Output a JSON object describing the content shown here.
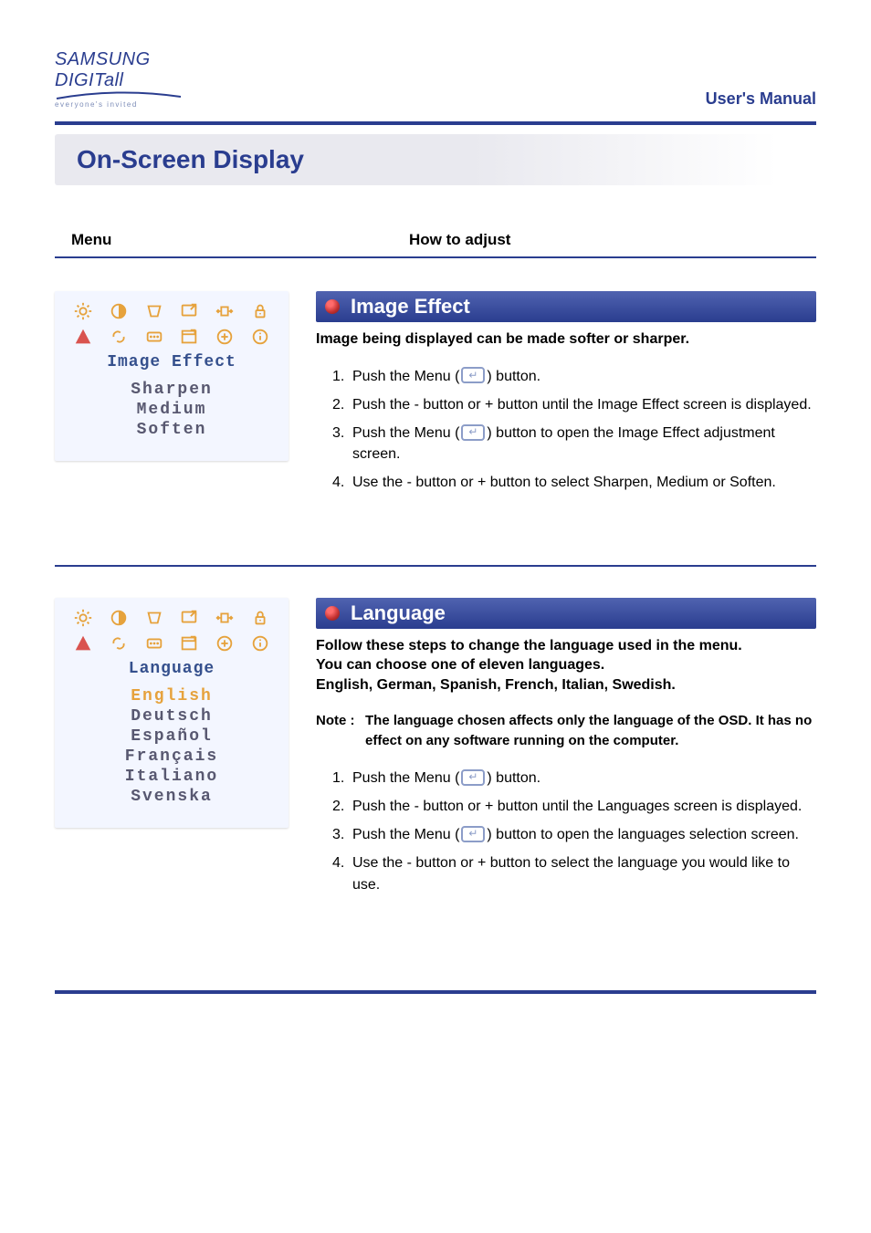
{
  "header": {
    "brand": "SAMSUNG DIGITall",
    "tagline": "everyone's invited",
    "manual": "User's Manual"
  },
  "page_title": "On-Screen Display",
  "column_headers": {
    "menu": "Menu",
    "howto": "How to adjust"
  },
  "sections": [
    {
      "osd": {
        "title": "Image Effect",
        "options": [
          "Sharpen",
          "Medium",
          "Soften"
        ],
        "selected_index": -1
      },
      "heading": "Image Effect",
      "intro": "Image being displayed can be made softer or sharper.",
      "steps": [
        {
          "pre": "Push the Menu (",
          "mid_icon": true,
          "post": ") button."
        },
        {
          "text": "Push the - button or + button until the Image Effect screen is displayed."
        },
        {
          "pre": "Push the Menu (",
          "mid_icon": true,
          "post": ") button to open the Image Effect adjustment screen."
        },
        {
          "text": "Use the - button or + button to select Sharpen, Medium or Soften."
        }
      ]
    },
    {
      "osd": {
        "title": "Language",
        "options": [
          "English",
          "Deutsch",
          "Español",
          "Français",
          "Italiano",
          "Svenska"
        ],
        "selected_index": 0
      },
      "heading": "Language",
      "intro": "Follow these steps to change the language used in the menu.\nYou can choose one of eleven languages.\nEnglish, German, Spanish, French, Italian, Swedish.",
      "note": {
        "label": "Note :",
        "text": "The language chosen affects only the language of the OSD. It has no effect on any software running on the computer."
      },
      "steps": [
        {
          "pre": "Push the Menu (",
          "mid_icon": true,
          "post": ") button."
        },
        {
          "text": "Push the - button or + button until the Languages screen is displayed."
        },
        {
          "pre": "Push the Menu (",
          "mid_icon": true,
          "post": ") button to open the languages selection screen."
        },
        {
          "text": "Use the - button or + button to select the language you would like to use."
        }
      ]
    }
  ],
  "osd_icons": {
    "row1": [
      "sun-icon",
      "contrast-icon",
      "trapezoid-icon",
      "screen-icon",
      "expand-icon",
      "lock-recall-icon"
    ],
    "row2": [
      "warning-icon",
      "link-icon",
      "color-icon",
      "window-icon",
      "plus-icon",
      "info-icon"
    ]
  }
}
